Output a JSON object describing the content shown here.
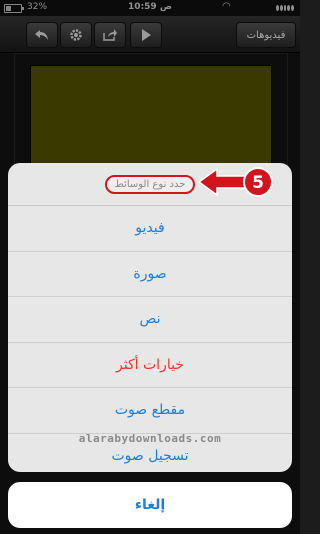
{
  "status_bar": {
    "time": "10:59 ص",
    "battery_percent": "32%"
  },
  "toolbar": {
    "videos_label": "فيديوهات",
    "icons": [
      "undo-icon",
      "gear-icon",
      "share-icon",
      "play-icon"
    ]
  },
  "colors": {
    "preview": "#5a5a00",
    "accent_blue": "#1a7fe0",
    "destructive_red": "#f0342c",
    "annotation_red": "#d4141c"
  },
  "action_sheet": {
    "title": "حدد نوع الوسائط",
    "items": [
      {
        "label": "فيديو",
        "style": "default"
      },
      {
        "label": "صورة",
        "style": "default"
      },
      {
        "label": "نص",
        "style": "default"
      },
      {
        "label": "خيارات أكثر",
        "style": "destructive"
      },
      {
        "label": "مقطع صوت",
        "style": "default"
      },
      {
        "label": "تسجيل صوت",
        "style": "default"
      }
    ],
    "cancel_label": "إلغاء"
  },
  "annotation": {
    "step_number": "5"
  },
  "watermark": "alarabydownloads.com"
}
